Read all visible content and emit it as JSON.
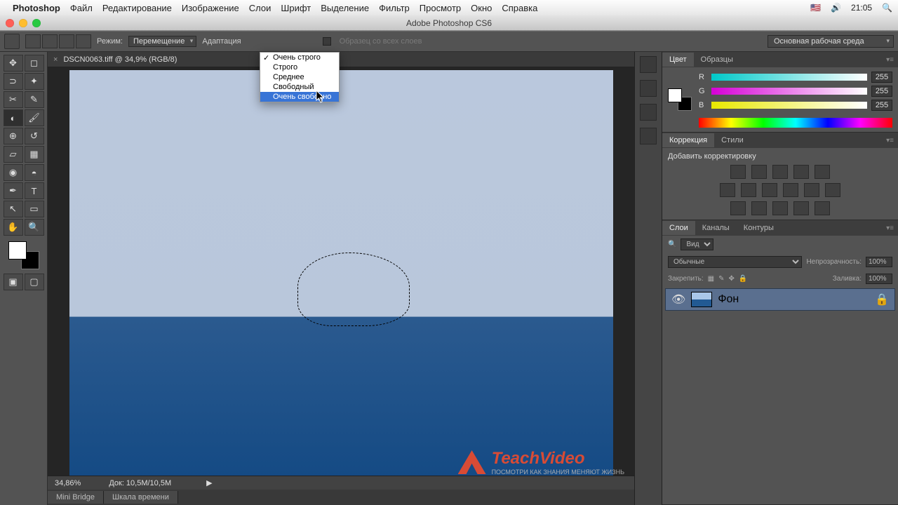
{
  "mac_menu": {
    "apple": "",
    "app": "Photoshop",
    "items": [
      "Файл",
      "Редактирование",
      "Изображение",
      "Слои",
      "Шрифт",
      "Выделение",
      "Фильтр",
      "Просмотр",
      "Окно",
      "Справка"
    ],
    "clock": "21:05"
  },
  "window_title": "Adobe Photoshop CS6",
  "options": {
    "mode_label": "Режим:",
    "mode_value": "Перемещение",
    "adapt_label": "Адаптация",
    "sample_all": "Образец со всех слоев",
    "workspace": "Основная рабочая среда"
  },
  "dropdown": {
    "items": [
      {
        "label": "Очень строго",
        "checked": true,
        "hl": false
      },
      {
        "label": "Строго",
        "checked": false,
        "hl": false
      },
      {
        "label": "Среднее",
        "checked": false,
        "hl": false
      },
      {
        "label": "Свободный",
        "checked": false,
        "hl": false
      },
      {
        "label": "Очень свободно",
        "checked": false,
        "hl": true
      }
    ]
  },
  "doc_tab": "DSCN0063.tiff @ 34,9% (RGB/8)",
  "status": {
    "zoom": "34,86%",
    "doc": "Док: 10,5M/10,5M"
  },
  "footer_tabs": [
    "Mini Bridge",
    "Шкала времени"
  ],
  "panels": {
    "color_tabs": [
      "Цвет",
      "Образцы"
    ],
    "r": "R",
    "g": "G",
    "b": "B",
    "rval": "255",
    "gval": "255",
    "bval": "255",
    "corr_tabs": [
      "Коррекция",
      "Стили"
    ],
    "corr_title": "Добавить корректировку",
    "layer_tabs": [
      "Слои",
      "Каналы",
      "Контуры"
    ],
    "kind_label": "Вид",
    "blend": "Обычные",
    "opacity_label": "Непрозрачность:",
    "opacity_val": "100%",
    "lock_label": "Закрепить:",
    "fill_label": "Заливка:",
    "fill_val": "100%",
    "layer_name": "Фон"
  },
  "watermark": {
    "brand": "TeachVideo",
    "sub": "ПОСМОТРИ КАК ЗНАНИЯ МЕНЯЮТ ЖИЗНЬ"
  }
}
